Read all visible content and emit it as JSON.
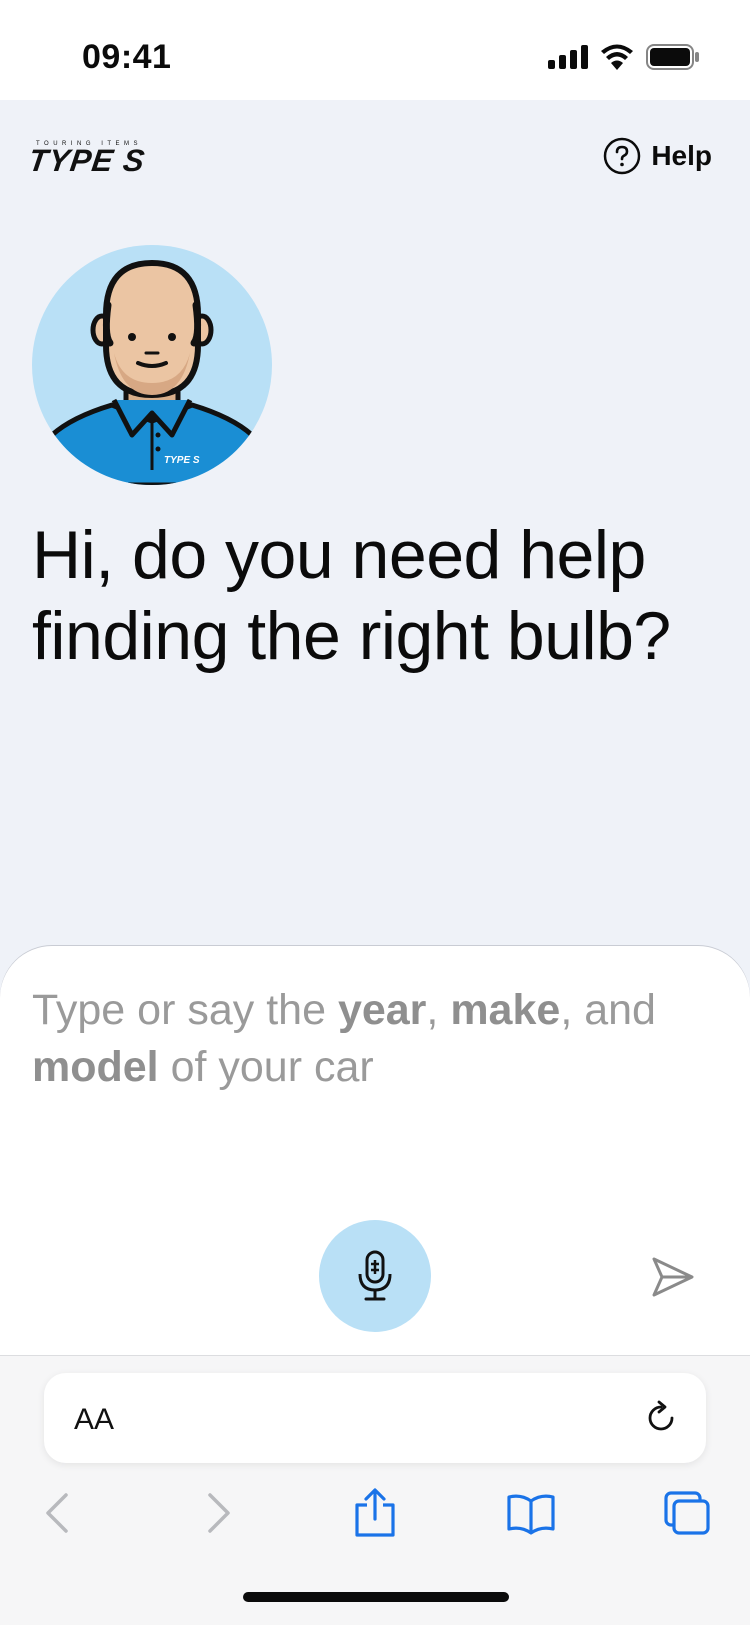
{
  "status_bar": {
    "time": "09:41"
  },
  "header": {
    "brand_tagline": "TOURING ITEMS",
    "brand_name": "TYPE S",
    "help_label": "Help"
  },
  "avatar": {
    "shirt_logo": "TYPE S"
  },
  "main": {
    "headline": "Hi, do you need help finding the right bulb?"
  },
  "composer": {
    "prompt_parts": [
      {
        "text": "Type or say the ",
        "bold": false
      },
      {
        "text": "year",
        "bold": true
      },
      {
        "text": ", ",
        "bold": false
      },
      {
        "text": "make",
        "bold": true
      },
      {
        "text": ", and ",
        "bold": false
      },
      {
        "text": "model",
        "bold": true
      },
      {
        "text": " of your car",
        "bold": false
      }
    ]
  },
  "browser": {
    "text_size_label": "AA"
  },
  "colors": {
    "page_background": "#eff2f8",
    "avatar_background": "#b9e0f6",
    "mic_button": "#b9e0f6",
    "shirt_blue": "#1a8ed4",
    "toolbar_accent": "#1a73e8"
  },
  "icons": [
    "signal-icon",
    "wifi-icon",
    "battery-icon",
    "help-circle-icon",
    "microphone-icon",
    "send-icon",
    "reload-icon",
    "back-icon",
    "forward-icon",
    "share-icon",
    "bookmarks-icon",
    "tabs-icon"
  ]
}
